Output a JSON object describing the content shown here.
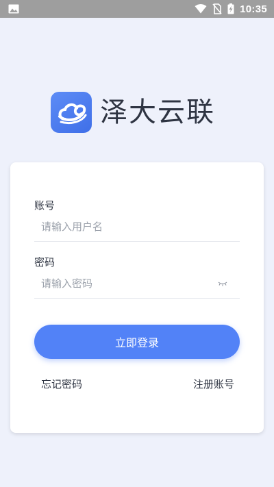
{
  "status_bar": {
    "time": "10:35",
    "icons": [
      "image-icon",
      "wifi-icon",
      "no-sim-icon",
      "battery-charging-icon"
    ]
  },
  "brand": {
    "title": "泽大云联",
    "logo_icon": "cloud-link-logo-icon",
    "logo_color": "#4c7ef3"
  },
  "login_form": {
    "account_label": "账号",
    "account_placeholder": "请输入用户名",
    "account_value": "",
    "password_label": "密码",
    "password_placeholder": "请输入密码",
    "password_value": "",
    "password_toggle_icon": "eye-closed-icon",
    "submit_label": "立即登录",
    "forgot_label": "忘记密码",
    "register_label": "注册账号"
  },
  "colors": {
    "accent": "#5282f7",
    "background": "#eef1fb",
    "status_bar": "#9e9e9e"
  }
}
